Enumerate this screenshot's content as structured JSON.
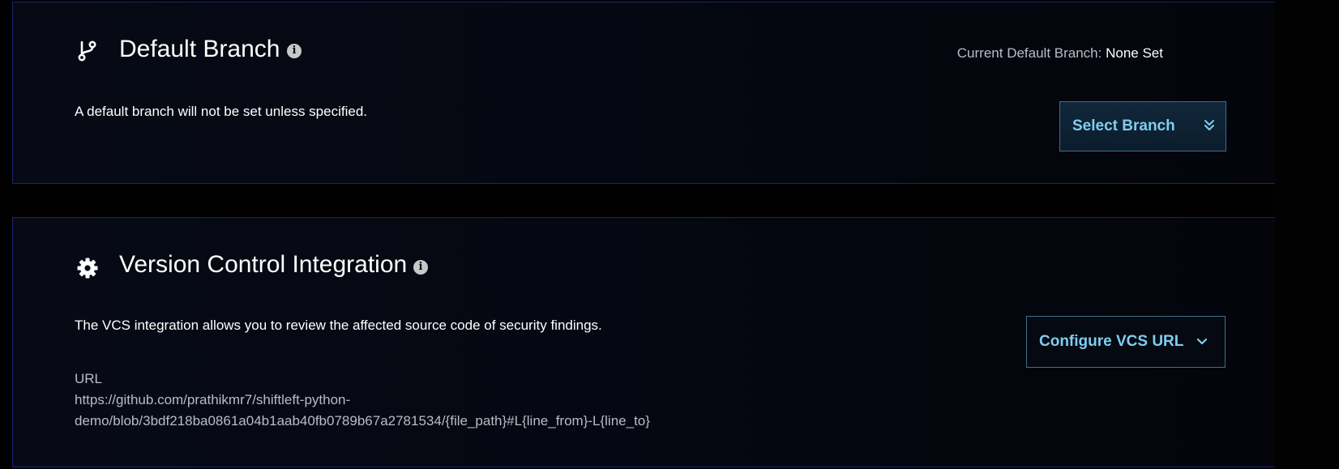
{
  "default_branch": {
    "title": "Default Branch",
    "info_icon": "info-icon",
    "section_icon": "git-branch-icon",
    "current_label": "Current Default Branch:",
    "current_value": "None Set",
    "description": "A default branch will not be set unless specified.",
    "select_button_label": "Select Branch",
    "select_button_icon": "double-chevron-down-icon"
  },
  "vcs": {
    "title": "Version Control Integration",
    "info_icon": "info-icon",
    "section_icon": "gear-cog-icon",
    "description": "The VCS integration allows you to review the affected source code of security findings.",
    "configure_button_label": "Configure VCS URL",
    "configure_button_icon": "chevron-down-icon",
    "url_label": "URL",
    "url_line1": "https://github.com/prathikmr7/shiftleft-python-",
    "url_line2": "demo/blob/3bdf218ba0861a04b1aab40fb0789b67a2781534/{file_path}#L{line_from}-L{line_to}"
  },
  "colors": {
    "page_background": "#010102",
    "panel_border": "#1b2470",
    "button_text": "#7fcdf0",
    "button_border": "#3d6f8c",
    "muted_text": "#b8bcc6"
  }
}
